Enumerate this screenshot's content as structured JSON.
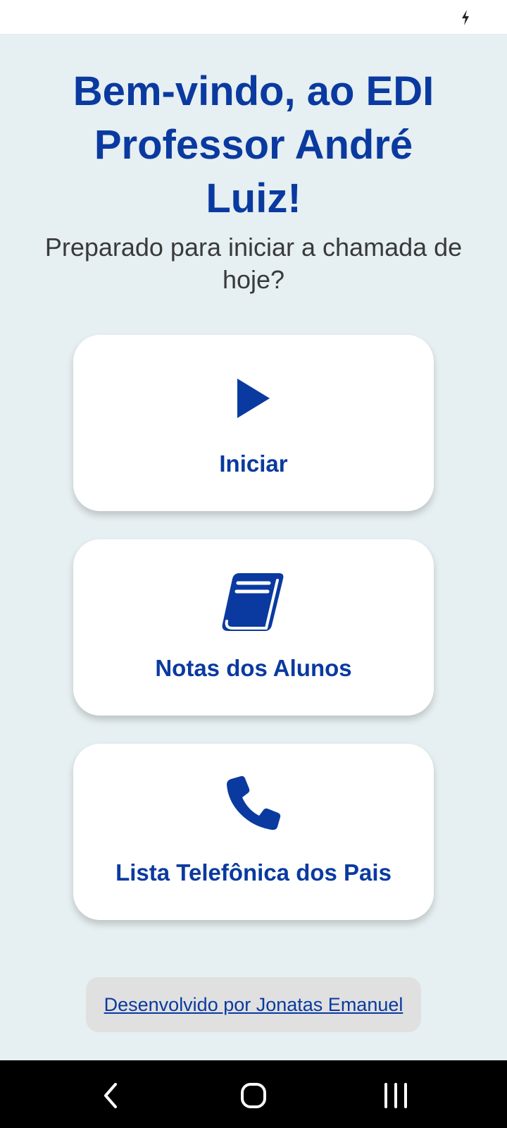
{
  "status_bar": {
    "icons": [
      "charging-bolt-icon"
    ]
  },
  "header": {
    "title": "Bem-vindo, ao EDI Professor André Luiz!",
    "subtitle": "Preparado para iniciar a chamada de hoje?"
  },
  "menu": {
    "items": [
      {
        "label": "Iniciar",
        "icon": "play-icon"
      },
      {
        "label": "Notas dos Alunos",
        "icon": "book-icon"
      },
      {
        "label": "Lista Telefônica dos Pais",
        "icon": "phone-icon"
      }
    ]
  },
  "footer": {
    "credit": "Desenvolvido por Jonatas Emanuel"
  },
  "nav_bar": {
    "buttons": [
      "back-icon",
      "home-icon",
      "recent-apps-icon"
    ]
  },
  "colors": {
    "accent": "#0a3aa0",
    "background": "#e6eff1",
    "card": "#ffffff",
    "credit_bg": "#e0e0e0"
  }
}
